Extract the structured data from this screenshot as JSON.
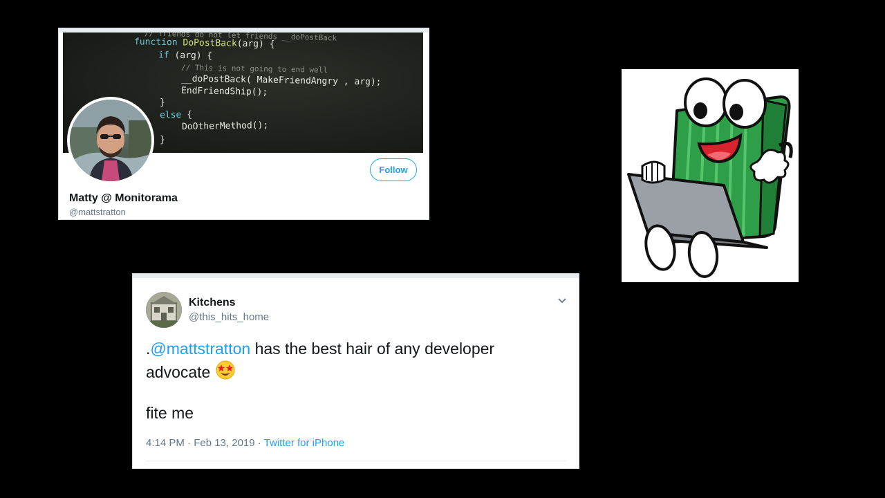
{
  "profile": {
    "banner_code": [
      "// friends do not let friends __doPostBack",
      "function DoPostBack(arg) {",
      "if (arg) {",
      "// This is not going to end well",
      "__doPostBack( MakeFriendAngry , arg);",
      "EndFriendShip();",
      "}",
      "else {",
      "DoOtherMethod();",
      "}"
    ],
    "display_name": "Matty @ Monitorama",
    "handle": "@mattstratton",
    "follow_label": "Follow"
  },
  "tweet": {
    "author_name": "Kitchens",
    "author_handle": "@this_hits_home",
    "text_prefix": ".",
    "mention": "@mattstratton",
    "text_body": " has the best hair of any developer advocate",
    "text_line2": "fite me",
    "time": "4:14 PM · Feb 13, 2019 · ",
    "source": "Twitter for iPhone"
  },
  "colors": {
    "background": "#000000",
    "twitter_blue": "#1da1f2",
    "mascot_green": "#2fa84f"
  }
}
